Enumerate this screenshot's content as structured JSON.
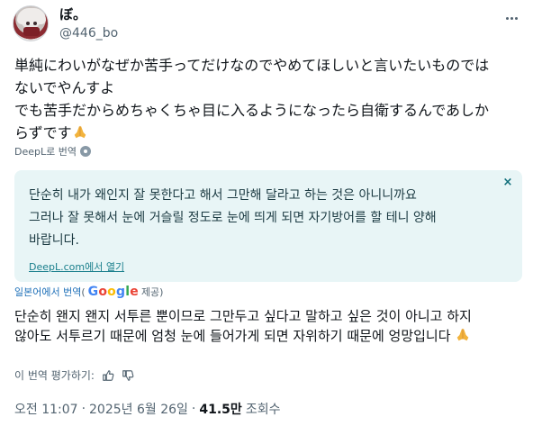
{
  "author": {
    "display_name": "ぼ。",
    "handle": "@446_bo"
  },
  "tweet": {
    "text_line1": "単純にわいがなぜか苦手ってだけなのでやめてほしいと言いたいものでは",
    "text_line2": "ないでやんすよ",
    "text_line3": "でも苦手だからめちゃくちゃ目に入るようになったら自衛するんであしか",
    "text_line4": "らずです"
  },
  "deepl": {
    "label": "DeepL로 번역",
    "translation_line1": "단순히 내가 왜인지 잘 못한다고 해서 그만해 달라고 하는 것은 아니니까요",
    "translation_line2": "그러나 잘 못해서 눈에 거슬릴 정도로 눈에 띄게 되면 자기방어를 할 테니 양해",
    "translation_line3": "바랍니다.",
    "close_label": "×",
    "link_label": "DeepL.com에서 열기"
  },
  "google": {
    "from_label": "일본어에서 번역",
    "paren_open": "(",
    "brand_letters": [
      "G",
      "o",
      "o",
      "g",
      "l",
      "e"
    ],
    "provided_label": "제공)",
    "translation_line1": "단순히 왠지 왠지 서투른 뿐이므로 그만두고 싶다고 말하고 싶은 것이 아니고 하지",
    "translation_line2": "않아도 서투르기 때문에 엄청 눈에 들어가게 되면 자위하기 때문에 엉망입니다"
  },
  "rating": {
    "label": "이 번역 평가하기:",
    "like_icon": "thumbs-up-icon",
    "dislike_icon": "thumbs-down-icon"
  },
  "meta": {
    "time": "오전 11:07",
    "separator": "·",
    "date": "2025년 6월 26일",
    "views_count": "41.5만",
    "views_label": "조회수"
  },
  "colors": {
    "accent": "#1a7f8c",
    "translation_bg": "#e8f5f6",
    "muted": "#536471"
  }
}
